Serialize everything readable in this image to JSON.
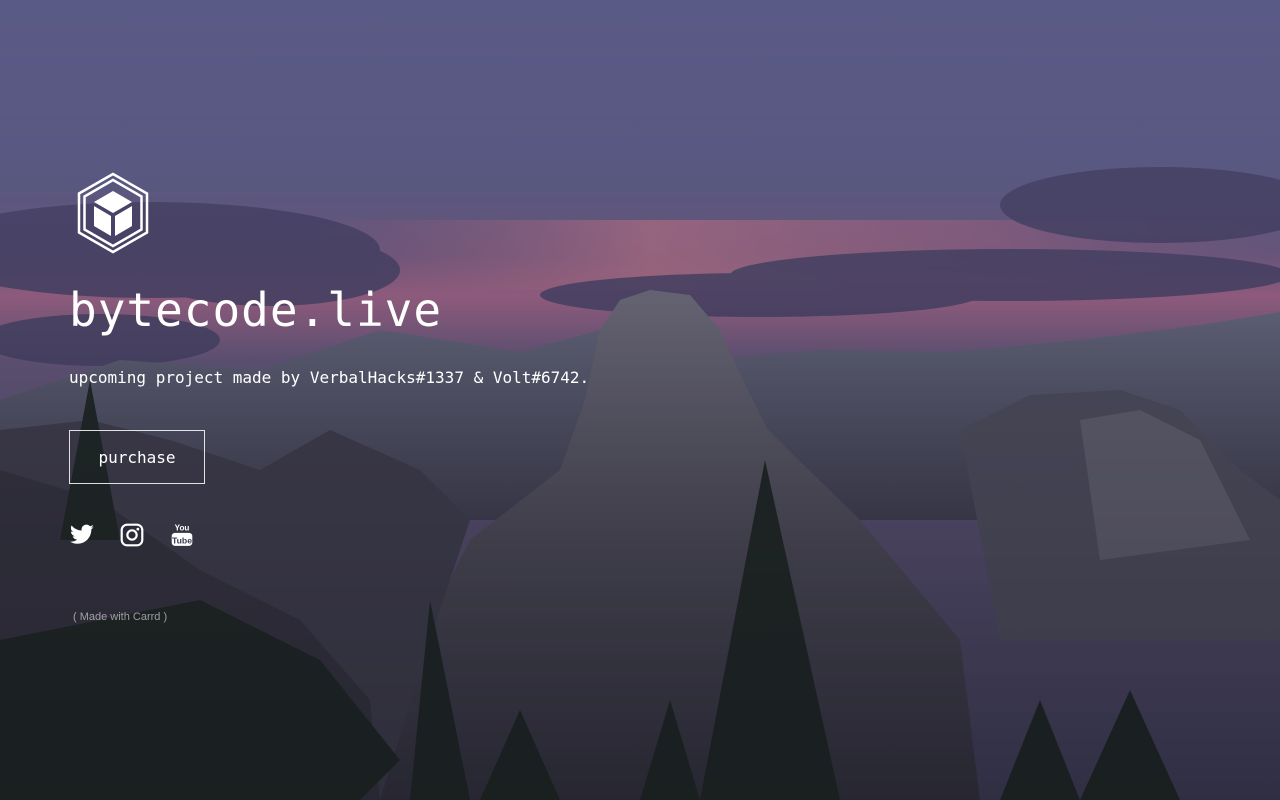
{
  "site": {
    "title": "bytecode.live",
    "tagline": "upcoming project made by VerbalHacks#1337 & Volt#6742.",
    "purchase_label": "purchase",
    "credit": "( Made with Carrd )"
  },
  "logo": {
    "icon": "cube-hexagon-icon"
  },
  "socials": [
    {
      "icon": "twitter-icon"
    },
    {
      "icon": "instagram-icon"
    },
    {
      "icon": "youtube-icon"
    }
  ],
  "colors": {
    "text": "#ffffff",
    "sky_top": "#6a6a9e",
    "sky_glow": "#c97aa6",
    "overlay": "#2b2d3f"
  }
}
